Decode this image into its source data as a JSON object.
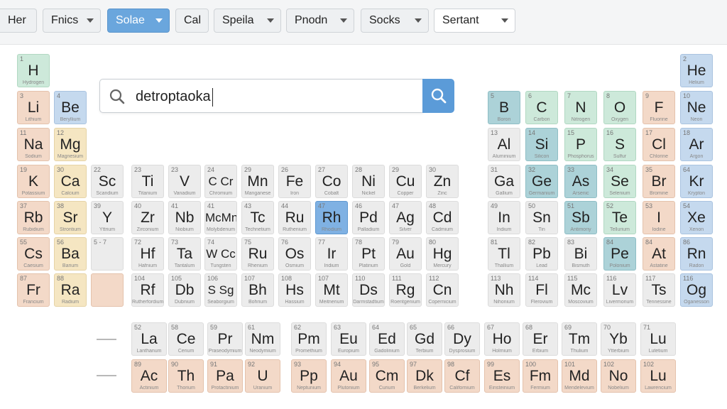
{
  "toolbar": {
    "items": [
      {
        "label": "Her",
        "caret": false,
        "style": "plain"
      },
      {
        "label": "Fnics",
        "caret": true,
        "style": "plain"
      },
      {
        "label": "Solae",
        "caret": true,
        "style": "active"
      },
      {
        "label": "Cal",
        "caret": false,
        "style": "plain"
      },
      {
        "label": "Speila",
        "caret": true,
        "style": "plain"
      },
      {
        "label": "Pnodn",
        "caret": true,
        "style": "plain"
      },
      {
        "label": "Socks",
        "caret": true,
        "style": "plain"
      },
      {
        "label": "Sertant",
        "caret": true,
        "style": "white"
      }
    ]
  },
  "search": {
    "value": "detroptaoka",
    "icon": "search-icon",
    "button_icon": "search-icon"
  },
  "colors": {
    "grey": "#ececec",
    "peach": "#f3d9c8",
    "yellow": "#f5e6c2",
    "blue": "#c5d9ee",
    "green": "#cde9da",
    "teal": "#acd2d8",
    "highlight": "#7fb1e3",
    "accent": "#5b9bd8"
  },
  "table": {
    "rows": [
      [
        {
          "n": "1",
          "s": "H",
          "name": "Hydrogen",
          "c": "green"
        }
      ],
      [
        {
          "n": "3",
          "s": "Li",
          "name": "Lithium",
          "c": "peach"
        },
        {
          "n": "4",
          "s": "Be",
          "name": "Beryllium",
          "c": "blue"
        },
        {
          "n": "5",
          "s": "B",
          "name": "Boron",
          "c": "teal"
        },
        {
          "n": "6",
          "s": "C",
          "name": "Carbon",
          "c": "green"
        },
        {
          "n": "7",
          "s": "N",
          "name": "Nitrogen",
          "c": "green"
        },
        {
          "n": "8",
          "s": "O",
          "name": "Oxygen",
          "c": "green"
        },
        {
          "n": "9",
          "s": "F",
          "name": "Fluorine",
          "c": "peach"
        },
        {
          "n": "10",
          "s": "Ne",
          "name": "Neon",
          "c": "blue"
        }
      ],
      [
        {
          "n": "11",
          "s": "Na",
          "name": "Sodium",
          "c": "peach"
        },
        {
          "n": "12",
          "s": "Mg",
          "name": "Magnesium",
          "c": "yellow"
        },
        {
          "n": "13",
          "s": "Al",
          "name": "Aluminium",
          "c": "grey"
        },
        {
          "n": "14",
          "s": "Si",
          "name": "Silicon",
          "c": "teal"
        },
        {
          "n": "15",
          "s": "P",
          "name": "Phosphorus",
          "c": "green"
        },
        {
          "n": "16",
          "s": "S",
          "name": "Sulfur",
          "c": "green"
        },
        {
          "n": "17",
          "s": "Cl",
          "name": "Chlorine",
          "c": "peach"
        },
        {
          "n": "18",
          "s": "Ar",
          "name": "Argon",
          "c": "blue"
        }
      ],
      [
        {
          "n": "19",
          "s": "K",
          "name": "Potassium",
          "c": "peach"
        },
        {
          "n": "30",
          "s": "Ca",
          "name": "Calcium",
          "c": "yellow"
        },
        {
          "n": "22",
          "s": "Sc",
          "name": "Scandium",
          "c": "grey"
        },
        {
          "n": "23",
          "s": "Ti",
          "name": "Titanium",
          "c": "grey"
        },
        {
          "n": "23",
          "s": "V",
          "name": "Vanadium",
          "c": "grey"
        },
        {
          "n": "24",
          "s": "C Cr",
          "name": "Chromium",
          "c": "grey"
        },
        {
          "n": "29",
          "s": "Mn",
          "name": "Manganese",
          "c": "grey"
        },
        {
          "n": "26",
          "s": "Fe",
          "name": "Iron",
          "c": "grey"
        },
        {
          "n": "27",
          "s": "Co",
          "name": "Cobalt",
          "c": "grey"
        },
        {
          "n": "28",
          "s": "Ni",
          "name": "Nickel",
          "c": "grey"
        },
        {
          "n": "29",
          "s": "Cu",
          "name": "Copper",
          "c": "grey"
        },
        {
          "n": "30",
          "s": "Zn",
          "name": "Zinc",
          "c": "grey"
        },
        {
          "n": "31",
          "s": "Ga",
          "name": "Gallium",
          "c": "grey"
        },
        {
          "n": "32",
          "s": "Ge",
          "name": "Germanium",
          "c": "teal"
        },
        {
          "n": "33",
          "s": "As",
          "name": "Arsenic",
          "c": "teal"
        },
        {
          "n": "34",
          "s": "Se",
          "name": "Selenium",
          "c": "green"
        },
        {
          "n": "35",
          "s": "Br",
          "name": "Bromine",
          "c": "peach"
        },
        {
          "n": "64",
          "s": "Kr",
          "name": "Krypton",
          "c": "blue"
        }
      ],
      [
        {
          "n": "37",
          "s": "Rb",
          "name": "Rubidium",
          "c": "peach"
        },
        {
          "n": "38",
          "s": "Sr",
          "name": "Strontium",
          "c": "yellow"
        },
        {
          "n": "39",
          "s": "Y",
          "name": "Yttrium",
          "c": "grey"
        },
        {
          "n": "40",
          "s": "Zr",
          "name": "Zirconium",
          "c": "grey"
        },
        {
          "n": "41",
          "s": "Nb",
          "name": "Niobium",
          "c": "grey"
        },
        {
          "n": "41",
          "s": "McMn",
          "name": "Molybdenum",
          "c": "grey"
        },
        {
          "n": "43",
          "s": "Tc",
          "name": "Technetium",
          "c": "grey"
        },
        {
          "n": "44",
          "s": "Ru",
          "name": "Ruthenium",
          "c": "grey"
        },
        {
          "n": "47",
          "s": "Rh",
          "name": "Rhodium",
          "c": "hl"
        },
        {
          "n": "46",
          "s": "Pd",
          "name": "Palladium",
          "c": "grey"
        },
        {
          "n": "47",
          "s": "Ag",
          "name": "Silver",
          "c": "grey"
        },
        {
          "n": "48",
          "s": "Cd",
          "name": "Cadmium",
          "c": "grey"
        },
        {
          "n": "49",
          "s": "In",
          "name": "Indium",
          "c": "grey"
        },
        {
          "n": "50",
          "s": "Sn",
          "name": "Tin",
          "c": "grey"
        },
        {
          "n": "51",
          "s": "Sb",
          "name": "Antimony",
          "c": "teal"
        },
        {
          "n": "52",
          "s": "Te",
          "name": "Tellurium",
          "c": "green"
        },
        {
          "n": "53",
          "s": "I",
          "name": "Iodine",
          "c": "peach"
        },
        {
          "n": "54",
          "s": "Xe",
          "name": "Xenon",
          "c": "blue"
        }
      ],
      [
        {
          "n": "55",
          "s": "Cs",
          "name": "Caesium",
          "c": "peach"
        },
        {
          "n": "56",
          "s": "Ba",
          "name": "Barium",
          "c": "yellow"
        },
        {
          "n": "5 - 7",
          "s": "",
          "name": "",
          "c": "grey"
        },
        {
          "n": "72",
          "s": "Hf",
          "name": "Hafnium",
          "c": "grey"
        },
        {
          "n": "73",
          "s": "Ta",
          "name": "Tantalum",
          "c": "grey"
        },
        {
          "n": "74",
          "s": "W Cc",
          "name": "Tungsten",
          "c": "grey"
        },
        {
          "n": "75",
          "s": "Ru",
          "name": "Rhenium",
          "c": "grey"
        },
        {
          "n": "76",
          "s": "Os",
          "name": "Osmium",
          "c": "grey"
        },
        {
          "n": "77",
          "s": "Ir",
          "name": "Iridium",
          "c": "grey"
        },
        {
          "n": "78",
          "s": "Pt",
          "name": "Platinum",
          "c": "grey"
        },
        {
          "n": "79",
          "s": "Au",
          "name": "Gold",
          "c": "grey"
        },
        {
          "n": "80",
          "s": "Hg",
          "name": "Mercury",
          "c": "grey"
        },
        {
          "n": "81",
          "s": "Tl",
          "name": "Thallium",
          "c": "grey"
        },
        {
          "n": "82",
          "s": "Pb",
          "name": "Lead",
          "c": "grey"
        },
        {
          "n": "83",
          "s": "Bi",
          "name": "Bismuth",
          "c": "grey"
        },
        {
          "n": "84",
          "s": "Pe",
          "name": "Polonium",
          "c": "teal"
        },
        {
          "n": "84",
          "s": "At",
          "name": "Astatine",
          "c": "peach"
        },
        {
          "n": "86",
          "s": "Rn",
          "name": "Radon",
          "c": "blue"
        }
      ],
      [
        {
          "n": "87",
          "s": "Fr",
          "name": "Francium",
          "c": "peach"
        },
        {
          "n": "88",
          "s": "Ra",
          "name": "Radium",
          "c": "yellow"
        },
        {
          "n": "",
          "s": "",
          "name": "",
          "c": "peach"
        },
        {
          "n": "104",
          "s": "Rf",
          "name": "Rutherfordium",
          "c": "grey"
        },
        {
          "n": "105",
          "s": "Db",
          "name": "Dubnium",
          "c": "grey"
        },
        {
          "n": "106",
          "s": "S Sg",
          "name": "Seaborgium",
          "c": "grey"
        },
        {
          "n": "107",
          "s": "Bh",
          "name": "Bohrium",
          "c": "grey"
        },
        {
          "n": "108",
          "s": "Hs",
          "name": "Hassium",
          "c": "grey"
        },
        {
          "n": "107",
          "s": "Mt",
          "name": "Meitnerium",
          "c": "grey"
        },
        {
          "n": "110",
          "s": "Ds",
          "name": "Darmstadtium",
          "c": "grey"
        },
        {
          "n": "111",
          "s": "Rg",
          "name": "Roentgenium",
          "c": "grey"
        },
        {
          "n": "112",
          "s": "Cn",
          "name": "Copernicium",
          "c": "grey"
        },
        {
          "n": "113",
          "s": "Nh",
          "name": "Nihonium",
          "c": "grey"
        },
        {
          "n": "114",
          "s": "Fl",
          "name": "Flerovium",
          "c": "grey"
        },
        {
          "n": "115",
          "s": "Mc",
          "name": "Moscovium",
          "c": "grey"
        },
        {
          "n": "116",
          "s": "Lv",
          "name": "Livermorium",
          "c": "grey"
        },
        {
          "n": "117",
          "s": "Ts",
          "name": "Tennessine",
          "c": "grey"
        },
        {
          "n": "116",
          "s": "Og",
          "name": "Oganesson",
          "c": "blue"
        }
      ]
    ],
    "lanthanides": [
      {
        "n": "52",
        "s": "La",
        "name": "Lanthanum",
        "c": "grey"
      },
      {
        "n": "58",
        "s": "Ce",
        "name": "Cerium",
        "c": "grey"
      },
      {
        "n": "59",
        "s": "Pr",
        "name": "Praseodymium",
        "c": "grey"
      },
      {
        "n": "61",
        "s": "Nm",
        "name": "Neodymium",
        "c": "grey"
      },
      {
        "n": "62",
        "s": "Pm",
        "name": "Promethium",
        "c": "grey"
      },
      {
        "n": "63",
        "s": "Eu",
        "name": "Europium",
        "c": "grey"
      },
      {
        "n": "64",
        "s": "Ed",
        "name": "Gadolinium",
        "c": "grey"
      },
      {
        "n": "65",
        "s": "Gd",
        "name": "Terbium",
        "c": "grey"
      },
      {
        "n": "66",
        "s": "Dy",
        "name": "Dysprosium",
        "c": "grey"
      },
      {
        "n": "67",
        "s": "Ho",
        "name": "Holmium",
        "c": "grey"
      },
      {
        "n": "68",
        "s": "Er",
        "name": "Erbium",
        "c": "grey"
      },
      {
        "n": "69",
        "s": "Tm",
        "name": "Thulium",
        "c": "grey"
      },
      {
        "n": "70",
        "s": "Yb",
        "name": "Ytterbium",
        "c": "grey"
      },
      {
        "n": "71",
        "s": "Lu",
        "name": "Lutetium",
        "c": "grey"
      }
    ],
    "actinides": [
      {
        "n": "89",
        "s": "Ac",
        "name": "Actinium",
        "c": "peach"
      },
      {
        "n": "90",
        "s": "Th",
        "name": "Thorium",
        "c": "peach"
      },
      {
        "n": "91",
        "s": "Pa",
        "name": "Protactinium",
        "c": "peach"
      },
      {
        "n": "92",
        "s": "U",
        "name": "Uranium",
        "c": "peach"
      },
      {
        "n": "93",
        "s": "Pp",
        "name": "Neptunium",
        "c": "peach"
      },
      {
        "n": "94",
        "s": "Au",
        "name": "Plutonium",
        "c": "peach"
      },
      {
        "n": "95",
        "s": "Cm",
        "name": "Curium",
        "c": "peach"
      },
      {
        "n": "97",
        "s": "Dk",
        "name": "Berkelium",
        "c": "peach"
      },
      {
        "n": "98",
        "s": "Cf",
        "name": "Californium",
        "c": "peach"
      },
      {
        "n": "99",
        "s": "Es",
        "name": "Einsteinium",
        "c": "peach"
      },
      {
        "n": "100",
        "s": "Fm",
        "name": "Fermium",
        "c": "peach"
      },
      {
        "n": "101",
        "s": "Md",
        "name": "Mendelevium",
        "c": "peach"
      },
      {
        "n": "102",
        "s": "No",
        "name": "Nobelium",
        "c": "peach"
      },
      {
        "n": "102",
        "s": "Lu",
        "name": "Lawrencium",
        "c": "peach"
      }
    ]
  }
}
